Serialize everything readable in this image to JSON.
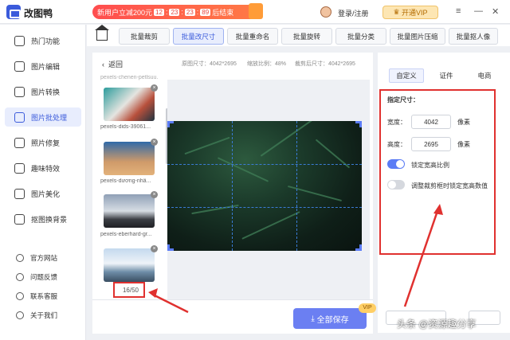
{
  "app": {
    "name": "改图鸭"
  },
  "promo": {
    "text": "新用户立减200元",
    "countdown": [
      "12",
      "23",
      "23",
      "89"
    ],
    "suffix": "后结束"
  },
  "header": {
    "login": "登录/注册",
    "vip": "开通VIP"
  },
  "sidebar": {
    "items": [
      {
        "label": "热门功能",
        "icon": "fire-icon"
      },
      {
        "label": "图片编辑",
        "icon": "edit-icon"
      },
      {
        "label": "图片转换",
        "icon": "convert-icon"
      },
      {
        "label": "图片批处理",
        "icon": "batch-icon",
        "active": true
      },
      {
        "label": "照片修复",
        "icon": "photo-fix-icon"
      },
      {
        "label": "趣味特效",
        "icon": "effect-icon"
      },
      {
        "label": "图片美化",
        "icon": "beautify-icon"
      },
      {
        "label": "抠图换背景",
        "icon": "cutout-icon"
      }
    ],
    "links": [
      "官方网站",
      "问题反馈",
      "联系客服",
      "关于我们"
    ]
  },
  "tabs": [
    "批量裁剪",
    "批量改尺寸",
    "批量重命名",
    "批量旋转",
    "批量分类",
    "批量图片压缩",
    "批量抠人像"
  ],
  "active_tab": "批量改尺寸",
  "editor": {
    "back": "返回",
    "original_size": "原图尺寸：4042*2695",
    "scale": "缩放比例：48%",
    "cropped_size": "裁剪后尺寸：4042*2695",
    "thumbnails": [
      {
        "caption": "pexels-chenen-petlsuu..."
      },
      {
        "caption": "pexels-dids-39061..."
      },
      {
        "caption": "pexels-dương-nhâ..."
      },
      {
        "caption": "pexels-eberhard-gr..."
      },
      {
        "caption": ""
      }
    ],
    "counter": "16/50",
    "save": "全部保存",
    "vip_tag": "VIP"
  },
  "settings": {
    "tabs": [
      "自定义",
      "证件",
      "电商"
    ],
    "active_tab": "自定义",
    "title": "指定尺寸：",
    "width_label": "宽度：",
    "width_value": "4042",
    "height_label": "高度：",
    "height_value": "2695",
    "unit": "像素",
    "lock_ratio": {
      "label": "锁定宽高比例",
      "on": true
    },
    "lock_crop": {
      "label": "调整裁剪框时锁定宽高数值",
      "on": false
    }
  },
  "watermark": "头条 @资源趣分享",
  "colors": {
    "accent": "#3b5bdb",
    "highlight": "#e0312f",
    "toggle_on": "#5b7cf5"
  }
}
